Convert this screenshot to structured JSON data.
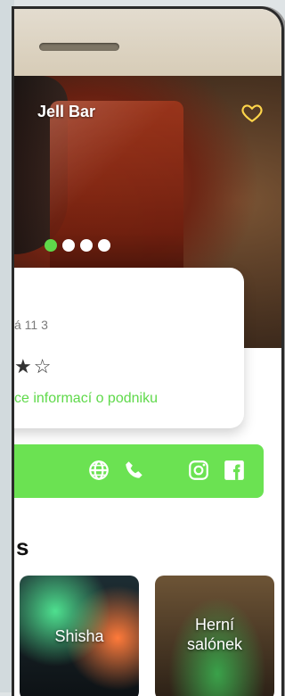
{
  "venue": {
    "title": "Jell Bar",
    "address": "á 11 3",
    "rating_stars": "★☆",
    "more_info": "ce informací o podniku"
  },
  "carousel": {
    "active_index": 0,
    "count": 4
  },
  "actions": {
    "web": "globe-icon",
    "phone": "phone-icon",
    "instagram": "instagram-icon",
    "facebook": "facebook-icon"
  },
  "section": {
    "title": "s"
  },
  "categories": [
    {
      "label": "Shisha"
    },
    {
      "label": "Herní salónek"
    }
  ],
  "colors": {
    "accent": "#6be252",
    "link": "#5fd94a",
    "heart": "#ffd54a"
  }
}
